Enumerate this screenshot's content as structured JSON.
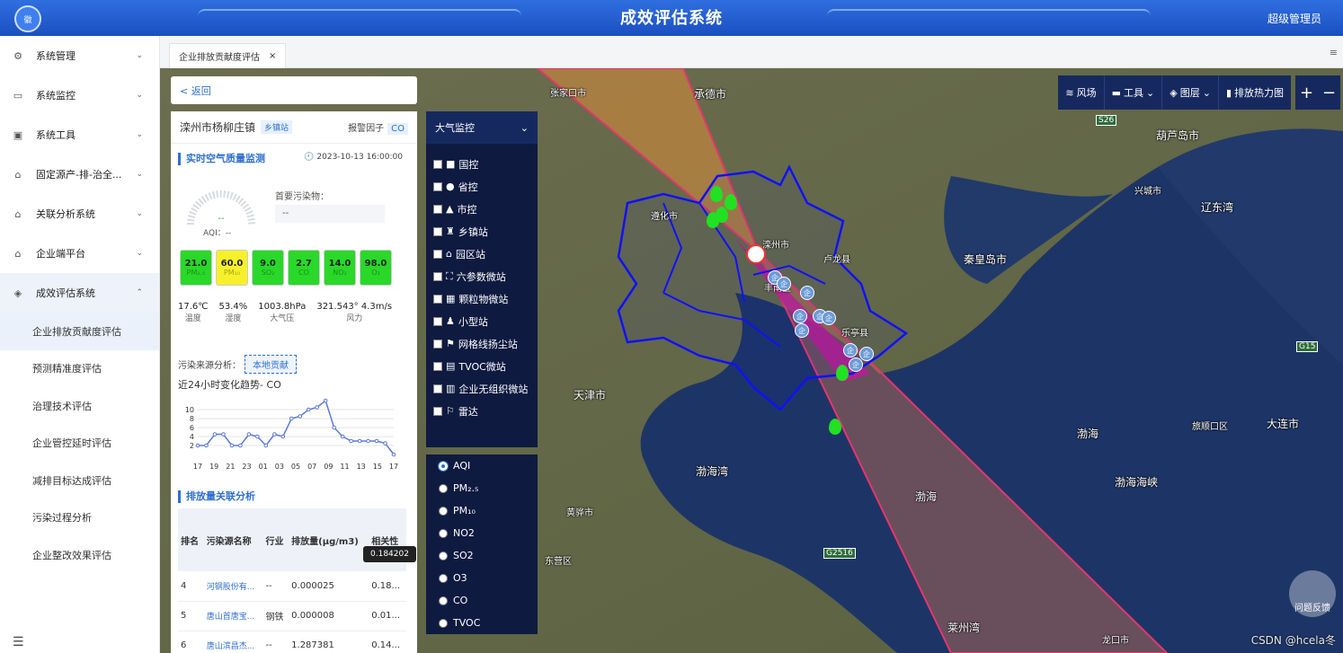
{
  "header": {
    "app_title": "成效评估系统",
    "user": "超级管理员",
    "logo_text": "徽"
  },
  "sidebar": {
    "items": [
      {
        "label": "系统管理",
        "icon": "gear-icon"
      },
      {
        "label": "系统监控",
        "icon": "monitor-icon"
      },
      {
        "label": "系统工具",
        "icon": "toolbox-icon"
      },
      {
        "label": "固定源产-排-治全...",
        "icon": "home-icon"
      },
      {
        "label": "关联分析系统",
        "icon": "home-icon"
      },
      {
        "label": "企业端平台",
        "icon": "home-icon"
      },
      {
        "label": "成效评估系统",
        "icon": "layers-icon"
      }
    ],
    "sub_items": [
      "企业排放贡献度评估",
      "预测精准度评估",
      "治理技术评估",
      "企业管控延时评估",
      "减排目标达成评估",
      "污染过程分析",
      "企业整改效果评估"
    ]
  },
  "tabs": {
    "active": "企业排放贡献度评估",
    "close": "×",
    "menu": "≡"
  },
  "map_toolbar": {
    "wind": "风场",
    "tools": "工具",
    "layers": "图层",
    "heatmap": "排放热力图",
    "zoom_in": "+",
    "zoom_out": "−"
  },
  "panel": {
    "back": "< 返回",
    "station_name": "滦州市杨柳庄镇",
    "station_type": "乡镇站",
    "alarm_label": "报警因子",
    "alarm_factor": "CO",
    "realtime_title": "实时空气质量监测",
    "timestamp": "2023-10-13 16:00:00",
    "gauge_value": "--",
    "aqi_label": "AQI：--",
    "primary_label": "首要污染物：",
    "primary_value": "--",
    "tiles": [
      {
        "value": "21.0",
        "name": "PM₂.₅",
        "color": "#29d829"
      },
      {
        "value": "60.0",
        "name": "PM₁₀",
        "color": "#f6f12a"
      },
      {
        "value": "9.0",
        "name": "SO₂",
        "color": "#29d829"
      },
      {
        "value": "2.7",
        "name": "CO",
        "color": "#29d829"
      },
      {
        "value": "14.0",
        "name": "NO₂",
        "color": "#29d829"
      },
      {
        "value": "98.0",
        "name": "O₃",
        "color": "#29d829"
      }
    ],
    "weather": [
      {
        "value": "17.6℃",
        "label": "温度"
      },
      {
        "value": "53.4%",
        "label": "湿度"
      },
      {
        "value": "1003.8hPa",
        "label": "大气压"
      },
      {
        "value": "321.543° 4.3m/s",
        "label": "风力"
      }
    ],
    "source_label": "污染来源分析：",
    "source_button": "本地贡献",
    "trend_title": "近24小时变化趋势- CO",
    "emission_title": "排放量关联分析",
    "table_headers": [
      "排名",
      "污染源名称",
      "行业",
      "排放量(μg/m3)",
      "相关性"
    ],
    "table_rows": [
      [
        "4",
        "河钢股份有...",
        "--",
        "0.000025",
        "0.18..."
      ],
      [
        "5",
        "唐山首唐宝...",
        "钢铁",
        "0.000008",
        "0.01..."
      ],
      [
        "6",
        "唐山滨昌杰...",
        "--",
        "1.287381",
        "0.14..."
      ]
    ],
    "tooltip": "0.184202"
  },
  "chart_data": {
    "type": "line",
    "title": "近24小时变化趋势- CO",
    "x": [
      "17",
      "18",
      "19",
      "20",
      "21",
      "22",
      "23",
      "00",
      "01",
      "02",
      "03",
      "04",
      "05",
      "06",
      "07",
      "08",
      "09",
      "10",
      "11",
      "12",
      "13",
      "14",
      "15",
      "16",
      "17"
    ],
    "x_tick_labels": [
      "17",
      "19",
      "21",
      "23",
      "01",
      "03",
      "05",
      "07",
      "09",
      "11",
      "13",
      "15",
      "17"
    ],
    "values": [
      2,
      2,
      4.5,
      4.5,
      2,
      2,
      4.5,
      4,
      2,
      4.5,
      4,
      8,
      8.5,
      10,
      10.5,
      12,
      6,
      4,
      3,
      3,
      3,
      3,
      2.5,
      0
    ],
    "y_ticks": [
      2,
      4,
      6,
      8,
      10
    ],
    "ylim": [
      0,
      12
    ]
  },
  "monitor": {
    "title": "大气监控",
    "items": [
      "国控",
      "省控",
      "市控",
      "乡镇站",
      "园区站",
      "六参数微站",
      "颗粒物微站",
      "小型站",
      "网格线扬尘站",
      "TVOC微站",
      "企业无组织微站",
      "雷达"
    ],
    "icons": [
      "square-icon",
      "circle-icon",
      "triangle-icon",
      "town-icon",
      "park-icon",
      "micro-icon",
      "particle-icon",
      "small-station-icon",
      "dust-icon",
      "tvoc-icon",
      "enterprise-icon",
      "radar-icon"
    ]
  },
  "pollutants": {
    "items": [
      "AQI",
      "PM₂.₅",
      "PM₁₀",
      "NO2",
      "SO2",
      "O3",
      "CO",
      "TVOC"
    ],
    "selected": "AQI"
  },
  "map_labels": {
    "places": [
      {
        "t": "承德市",
        "x": 594,
        "y": 20
      },
      {
        "t": "葫芦岛市",
        "x": 1108,
        "y": 66
      },
      {
        "t": "秦皇岛市",
        "x": 894,
        "y": 204
      },
      {
        "t": "天津市",
        "x": 460,
        "y": 355
      },
      {
        "t": "大连市",
        "x": 1231,
        "y": 387
      },
      {
        "t": "渤海湾",
        "x": 596,
        "y": 440
      },
      {
        "t": "渤海海峡",
        "x": 1062,
        "y": 452
      },
      {
        "t": "辽东湾",
        "x": 1158,
        "y": 146
      },
      {
        "t": "渤海",
        "x": 1020,
        "y": 398
      },
      {
        "t": "渤海",
        "x": 840,
        "y": 468
      },
      {
        "t": "莱州湾",
        "x": 876,
        "y": 614
      }
    ],
    "small": [
      {
        "t": "张家口市",
        "x": 434,
        "y": 19
      },
      {
        "t": "遵化市",
        "x": 546,
        "y": 156
      },
      {
        "t": "滦州市",
        "x": 670,
        "y": 188
      },
      {
        "t": "丰南区",
        "x": 672,
        "y": 236
      },
      {
        "t": "卢龙县",
        "x": 738,
        "y": 204
      },
      {
        "t": "兴城市",
        "x": 1084,
        "y": 128
      },
      {
        "t": "乐亭县",
        "x": 758,
        "y": 286
      },
      {
        "t": "旅顺口区",
        "x": 1148,
        "y": 390
      },
      {
        "t": "东营区",
        "x": 428,
        "y": 540
      },
      {
        "t": "黄骅市",
        "x": 452,
        "y": 486
      },
      {
        "t": "龙口市",
        "x": 1048,
        "y": 628
      }
    ],
    "roads": [
      {
        "t": "S26",
        "x": 1041,
        "y": 52
      },
      {
        "t": "G15",
        "x": 1264,
        "y": 304
      },
      {
        "t": "G2516",
        "x": 738,
        "y": 534
      }
    ]
  },
  "markers": {
    "enterprise_label": "企",
    "feedback": "问题反馈",
    "watermark": "CSDN @hcela冬"
  }
}
